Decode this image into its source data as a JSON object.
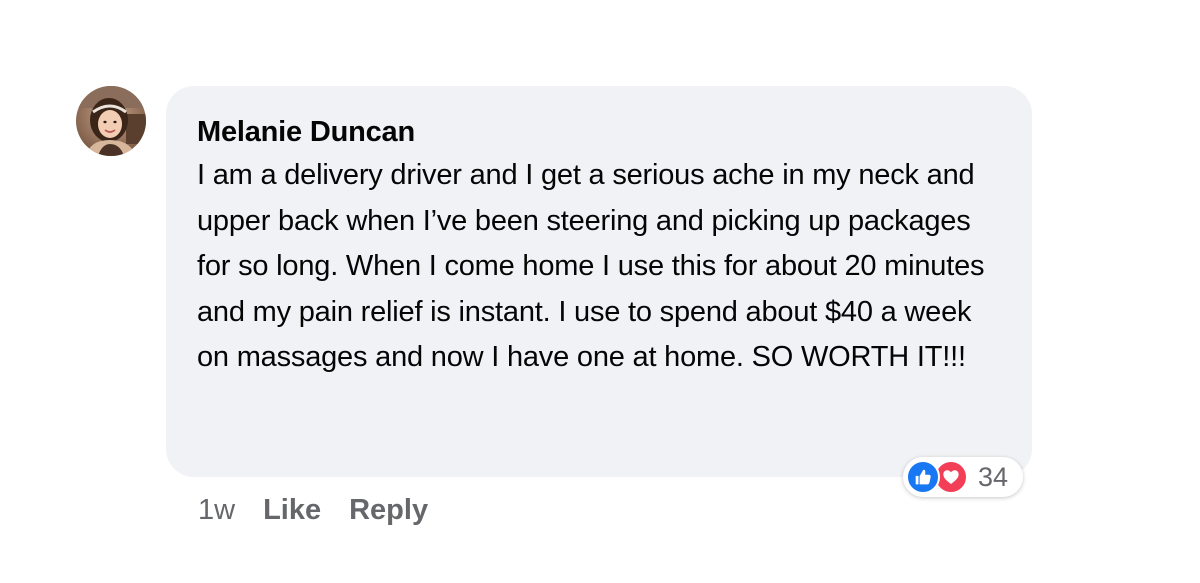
{
  "comment": {
    "author": "Melanie Duncan",
    "text": "I am a delivery driver and I get a serious ache in my neck and upper back when I’ve been steering and picking up packages for so long. When I come home I use this for about 20 minutes and my pain relief is instant. I use to spend about $40 a week on massages and now I have one at home. SO WORTH IT!!!",
    "timestamp": "1w",
    "like_label": "Like",
    "reply_label": "Reply",
    "reactions": {
      "count": "34",
      "types": [
        "like-icon",
        "love-icon"
      ]
    }
  },
  "colors": {
    "bubble_background": "#f0f2f5",
    "like_blue": "#1877f2",
    "love_red": "#f33e58",
    "secondary_text": "#65676b"
  }
}
